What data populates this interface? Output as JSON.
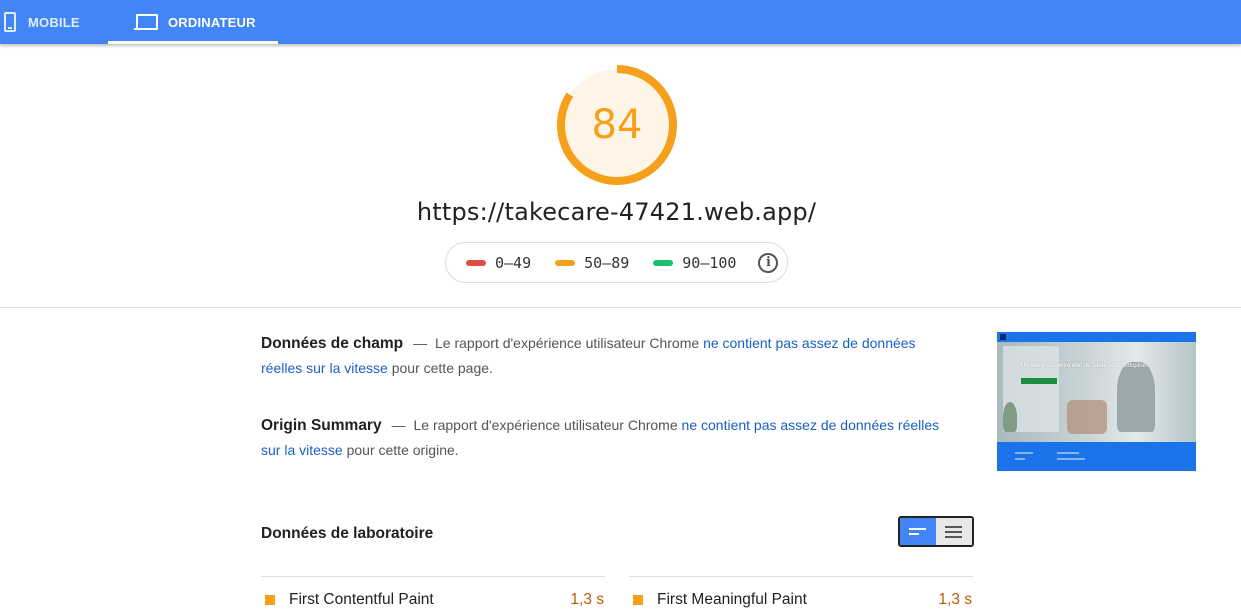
{
  "tabs": [
    {
      "label": "MOBILE",
      "icon": "phone-icon",
      "active": false
    },
    {
      "label": "ORDINATEUR",
      "icon": "laptop-icon",
      "active": true
    }
  ],
  "score": {
    "value": "84",
    "fraction": 0.84,
    "color": "#f4a01a"
  },
  "url": "https://takecare-47421.web.app/",
  "legend": [
    {
      "range": "0–49",
      "color": "#e44c41"
    },
    {
      "range": "50–89",
      "color": "#f4a01a"
    },
    {
      "range": "90–100",
      "color": "#1ec16a"
    }
  ],
  "field_data": {
    "title": "Données de champ",
    "dash": "—",
    "text_before": "Le rapport d'expérience utilisateur Chrome",
    "link": "ne contient pas assez de données réelles sur la vitesse",
    "text_after": "pour cette page."
  },
  "origin_summary": {
    "title": "Origin Summary",
    "dash": "—",
    "text_before": "Le rapport d'expérience utilisateur Chrome",
    "link": "ne contient pas assez de données réelles sur la vitesse",
    "text_after": "pour cette origine."
  },
  "thumbnail": {
    "headline": "Un doute sur votre état de santé vous turlupine..."
  },
  "lab_data": {
    "title": "Données de laboratoire",
    "metrics": [
      {
        "name": "First Contentful Paint",
        "value": "1,3 s",
        "color": "#f4a01a"
      },
      {
        "name": "First Meaningful Paint",
        "value": "1,3 s",
        "color": "#f4a01a"
      }
    ]
  }
}
